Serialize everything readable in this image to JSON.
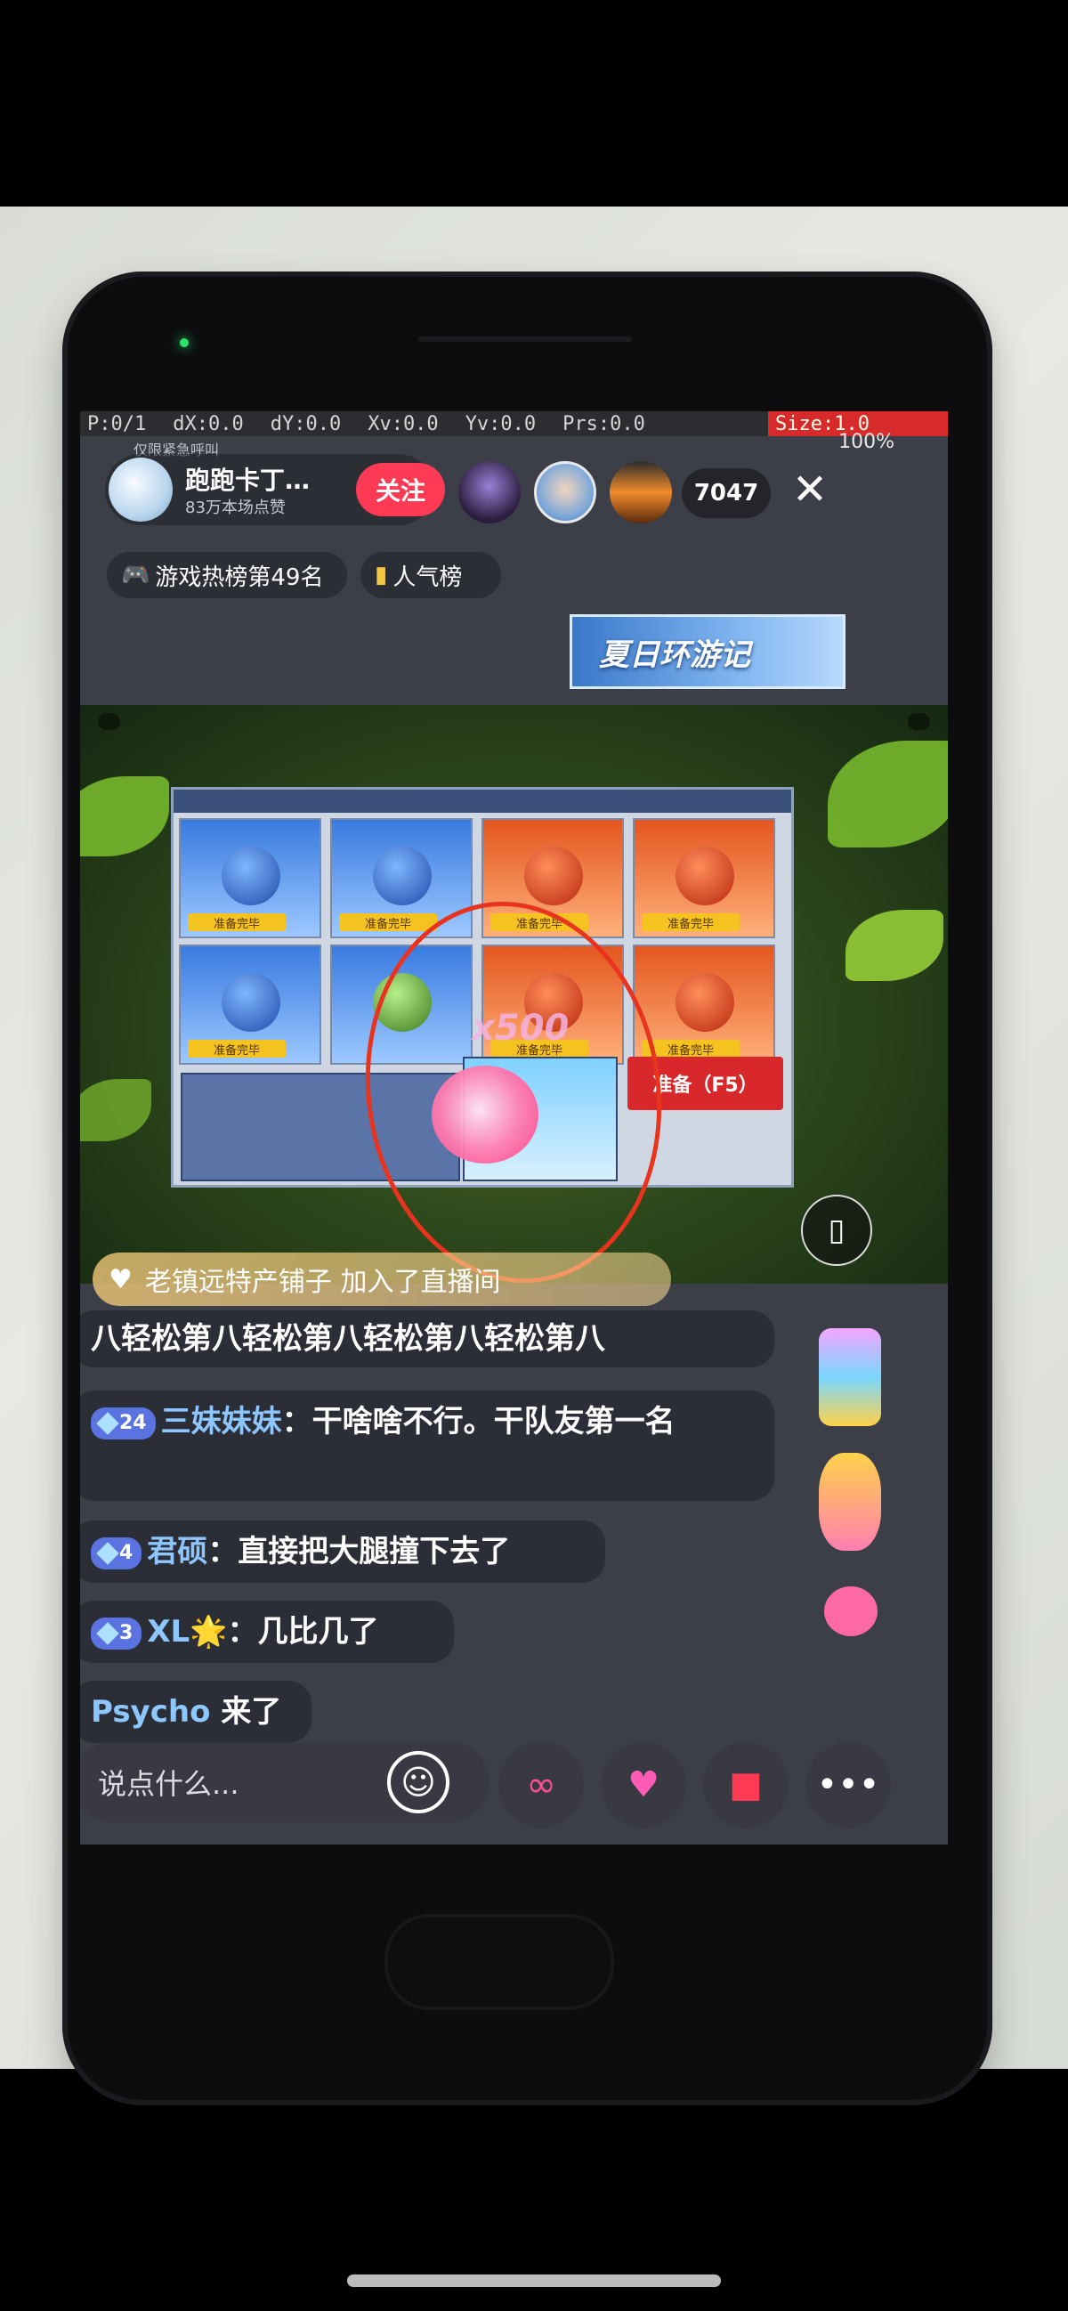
{
  "debug": {
    "p": "P:0/1",
    "dx": "dX:0.0",
    "dy": "dY:0.0",
    "xv": "Xv:0.0",
    "yv": "Yv:0.0",
    "prs": "Prs:0.0",
    "size": "Size:1.0"
  },
  "status": {
    "left_text": "仅限紧急呼叫",
    "battery": "100%"
  },
  "streamer": {
    "name": "跑跑卡丁…",
    "likes": "83万本场点赞",
    "follow_label": "关注",
    "viewer_count": "7047"
  },
  "tags": {
    "rank_label": "游戏热榜第49名",
    "popular_label": "人气榜"
  },
  "banner": {
    "title": "夏日环游记"
  },
  "game": {
    "ready_button": "准备（F5）",
    "slot_ready": "准备完毕",
    "gift_fx": "x500"
  },
  "join": {
    "text": "老镇远特产铺子 加入了直播间"
  },
  "chat": {
    "messages": [
      {
        "text": "八轻松第八轻松第八轻松第八轻松第八"
      },
      {
        "level": "24",
        "name": "三妹妹妹",
        "text": "：干啥啥不行。干队友第一名"
      },
      {
        "level": "4",
        "name": "君硕",
        "text": "：直接把大腿撞下去了"
      },
      {
        "level": "3",
        "name": "XL🌟",
        "text": "：几比几了"
      },
      {
        "name": "Psycho",
        "text": " 来了"
      }
    ]
  },
  "bottom": {
    "input_placeholder": "说点什么..."
  },
  "icons": {
    "close": "close-icon",
    "gamepad": "gamepad-icon",
    "bars": "bar-chart-icon",
    "emoji": "smile-icon",
    "link": "link-icon",
    "heart": "heart-icon",
    "gift": "gift-icon",
    "more": "more-icon"
  }
}
